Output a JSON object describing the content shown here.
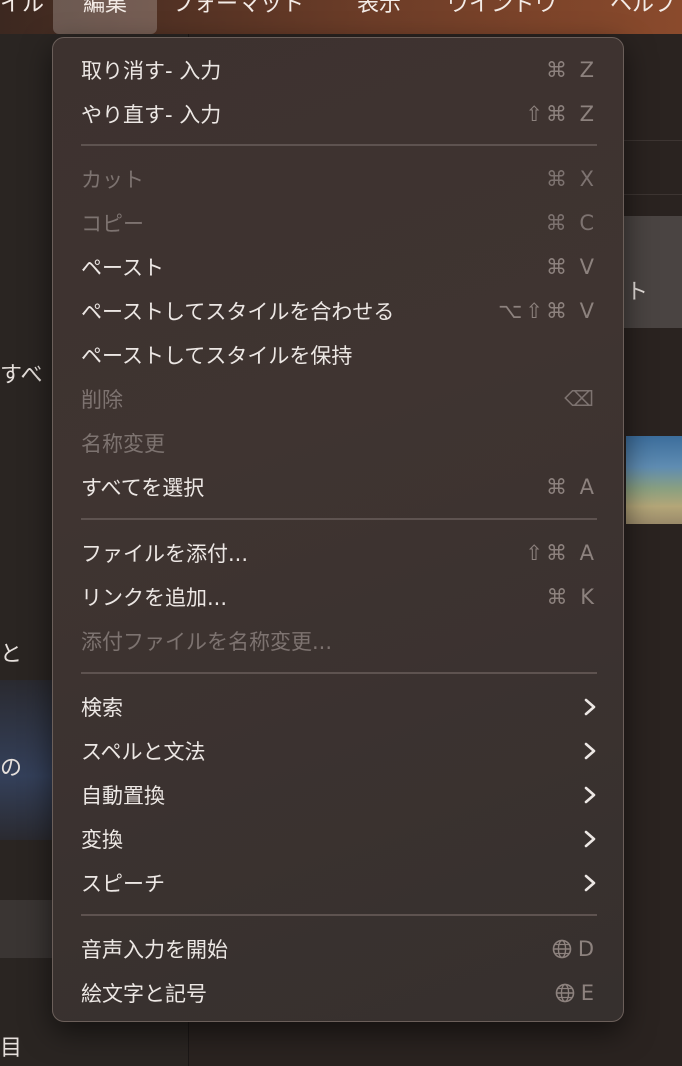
{
  "menubar": {
    "items": [
      "イル",
      "編集",
      "フォーマット",
      "表示",
      "ウインドウ",
      "ヘルプ"
    ],
    "active_index": 1
  },
  "background": {
    "sidebar_fragments": [
      "すべ",
      "と",
      "の",
      "目"
    ],
    "card_text": "ト"
  },
  "edit_menu": {
    "items": [
      {
        "label": "取り消す- 入力",
        "shortcut": "⌘ Z",
        "enabled": true
      },
      {
        "label": "やり直す- 入力",
        "shortcut": "⇧⌘ Z",
        "enabled": true
      },
      {
        "label": "カット",
        "shortcut": "⌘ X",
        "enabled": false
      },
      {
        "label": "コピー",
        "shortcut": "⌘ C",
        "enabled": false
      },
      {
        "label": "ペースト",
        "shortcut": "⌘ V",
        "enabled": true
      },
      {
        "label": "ペーストしてスタイルを合わせる",
        "shortcut": "⌥⇧⌘ V",
        "enabled": true
      },
      {
        "label": "ペーストしてスタイルを保持",
        "shortcut": "",
        "enabled": true
      },
      {
        "label": "削除",
        "shortcut": "⌫",
        "enabled": false
      },
      {
        "label": "名称変更",
        "shortcut": "",
        "enabled": false
      },
      {
        "label": "すべてを選択",
        "shortcut": "⌘ A",
        "enabled": true
      },
      {
        "label": "ファイルを添付...",
        "shortcut": "⇧⌘ A",
        "enabled": true
      },
      {
        "label": "リンクを追加...",
        "shortcut": "⌘ K",
        "enabled": true
      },
      {
        "label": "添付ファイルを名称変更...",
        "shortcut": "",
        "enabled": false
      },
      {
        "label": "検索",
        "submenu": true,
        "enabled": true
      },
      {
        "label": "スペルと文法",
        "submenu": true,
        "enabled": true
      },
      {
        "label": "自動置換",
        "submenu": true,
        "enabled": true
      },
      {
        "label": "変換",
        "submenu": true,
        "enabled": true
      },
      {
        "label": "スピーチ",
        "submenu": true,
        "enabled": true
      },
      {
        "label": "音声入力を開始",
        "shortcut_key": "D",
        "shortcut_icon": "globe-icon",
        "enabled": true
      },
      {
        "label": "絵文字と記号",
        "shortcut_key": "E",
        "shortcut_icon": "globe-icon",
        "enabled": true
      }
    ]
  },
  "colors": {
    "menu_bg": "#3d322f",
    "enabled_text": "#ece7e4",
    "disabled_text": "#7d7370",
    "shortcut_text": "#8d827e"
  }
}
